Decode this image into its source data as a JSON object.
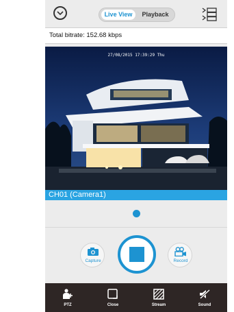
{
  "header": {
    "tabs": [
      {
        "label": "Live View",
        "active": true
      },
      {
        "label": "Playback",
        "active": false
      }
    ],
    "menu_icon": "chevron-down-circle-icon",
    "layout_icon": "layout-list-icon"
  },
  "status": {
    "bitrate": "Total bitrate: 152.68 kbps"
  },
  "video": {
    "osd_timestamp": "27/08/2015 17:39:29 Thu",
    "channel_label": "CH01 (Camera1)"
  },
  "pager": {
    "current": 1,
    "total": 1
  },
  "controls": {
    "capture_label": "Capture",
    "record_label": "Record",
    "stop_icon": "stop-icon"
  },
  "toolbar": {
    "items": [
      {
        "label": "PTZ",
        "icon": "ptz-icon"
      },
      {
        "label": "Close",
        "icon": "close-square-icon"
      },
      {
        "label": "Stream",
        "icon": "stream-icon"
      },
      {
        "label": "Sound",
        "icon": "mute-icon"
      }
    ]
  },
  "colors": {
    "accent": "#1d93d1",
    "channel_bar": "#2aa4e2",
    "toolbar_bg": "#2e2625",
    "app_bg": "#ececec"
  }
}
